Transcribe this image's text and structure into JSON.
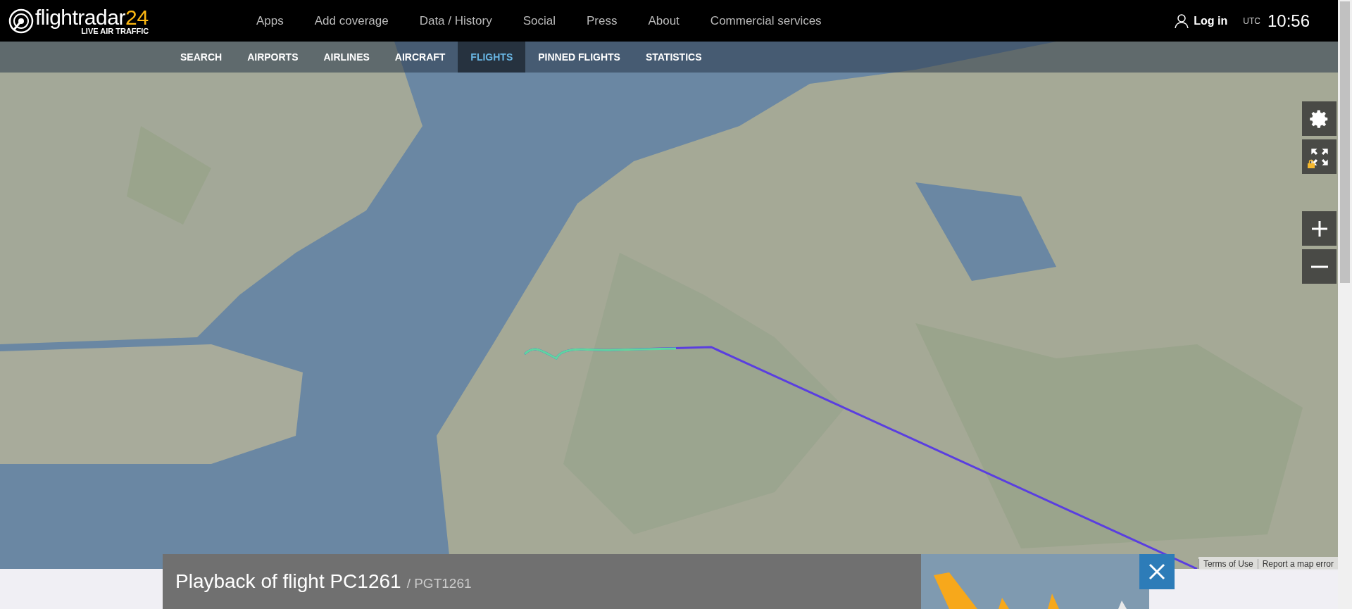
{
  "header": {
    "logo": {
      "word": "flightradar",
      "number": "24",
      "tagline": "LIVE AIR TRAFFIC"
    },
    "nav": [
      "Apps",
      "Add coverage",
      "Data / History",
      "Social",
      "Press",
      "About",
      "Commercial services"
    ],
    "login": "Log in",
    "clock": {
      "zone": "UTC",
      "time": "10:56"
    }
  },
  "subnav": [
    {
      "label": "SEARCH",
      "selected": false
    },
    {
      "label": "AIRPORTS",
      "selected": false
    },
    {
      "label": "AIRLINES",
      "selected": false
    },
    {
      "label": "AIRCRAFT",
      "selected": false
    },
    {
      "label": "FLIGHTS",
      "selected": true
    },
    {
      "label": "PINNED FLIGHTS",
      "selected": false
    },
    {
      "label": "STATISTICS",
      "selected": false
    }
  ],
  "map": {
    "attribution": [
      "Terms of Use",
      "Report a map error"
    ]
  },
  "playback": {
    "title": "Playback of flight PC1261",
    "callsign": "/ PGT1261"
  }
}
